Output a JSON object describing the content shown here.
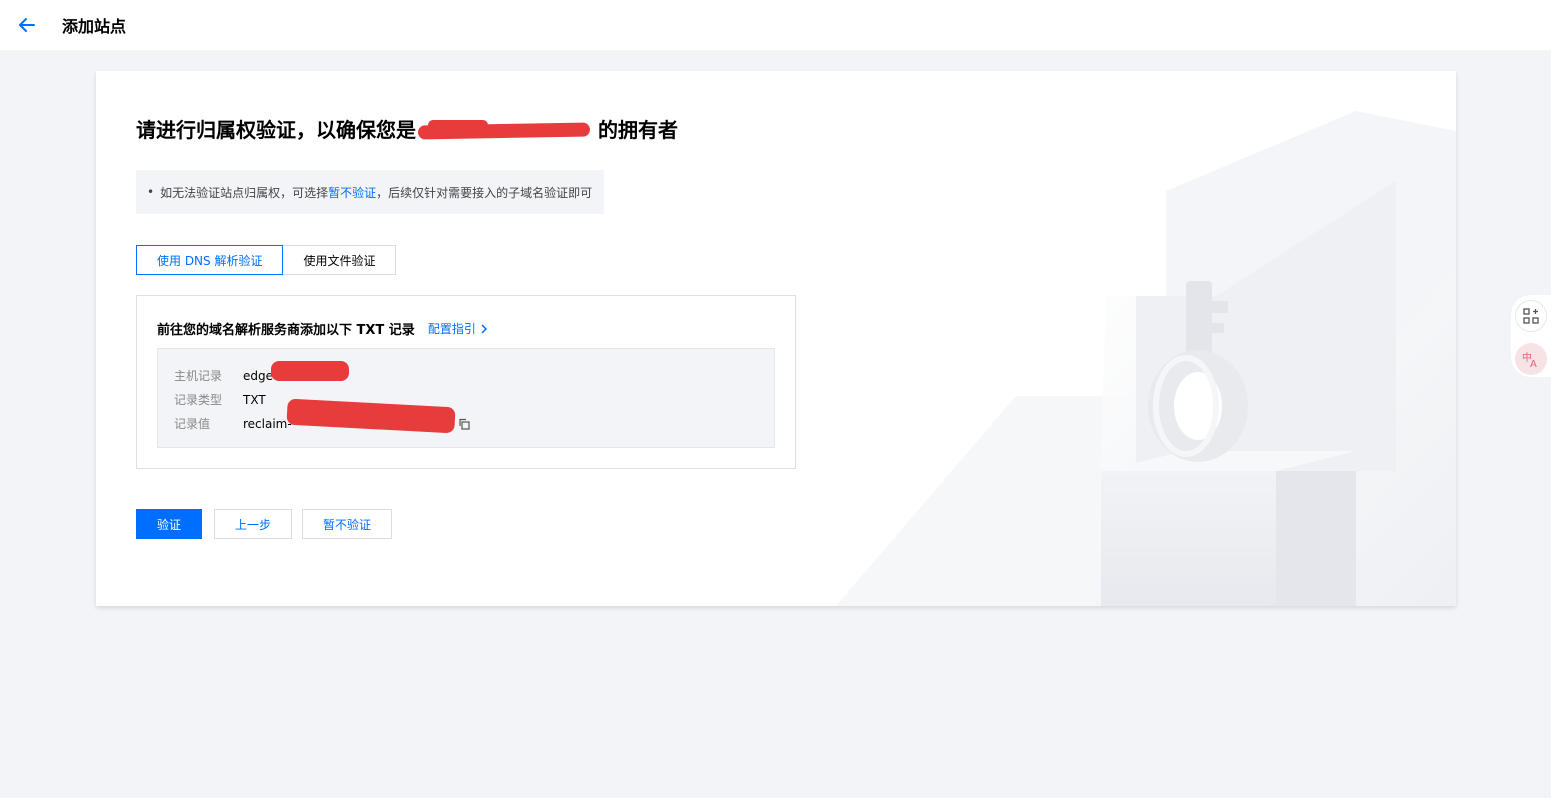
{
  "header": {
    "title": "添加站点"
  },
  "card": {
    "title_prefix": "请进行归属权验证，以确保您是",
    "title_suffix": "的拥有者",
    "notice": {
      "bullet": "•",
      "text_before": "如无法验证站点归属权，可选择",
      "link": "暂不验证",
      "text_after": "，后续仅针对需要接入的子域名验证即可"
    },
    "tabs": [
      {
        "label": "使用 DNS 解析验证",
        "active": true
      },
      {
        "label": "使用文件验证",
        "active": false
      }
    ],
    "record": {
      "heading": "前往您的域名解析服务商添加以下 TXT 记录",
      "guide_link": "配置指引",
      "rows": [
        {
          "label": "主机记录",
          "value": "edge"
        },
        {
          "label": "记录类型",
          "value": "TXT"
        },
        {
          "label": "记录值",
          "value": "reclaim-"
        }
      ]
    },
    "actions": {
      "verify": "验证",
      "prev": "上一步",
      "skip": "暂不验证"
    }
  },
  "icons": {
    "back": "arrow-left-icon",
    "copy": "copy-icon",
    "chevron": "chevron-right-icon",
    "apps": "apps-add-icon",
    "translate": "translate-icon"
  },
  "colors": {
    "accent": "#006eff",
    "page_bg": "#f3f4f7",
    "redaction": "#e63c3c"
  }
}
